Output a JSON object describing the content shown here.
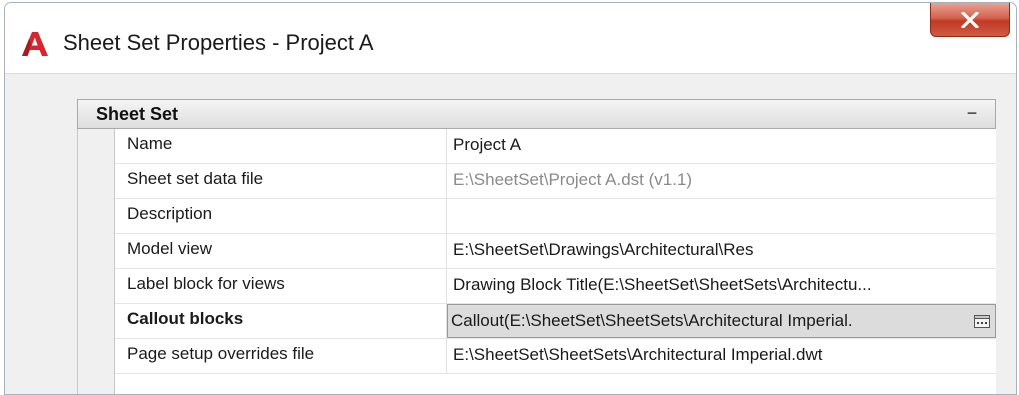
{
  "window": {
    "title": "Sheet Set Properties - Project A",
    "close_label": "X"
  },
  "category": {
    "title": "Sheet Set",
    "collapse_symbol": "−"
  },
  "properties": [
    {
      "name": "Name",
      "value": "Project A"
    },
    {
      "name": "Sheet set data file",
      "value": "E:\\SheetSet\\Project A.dst (v1.1)"
    },
    {
      "name": "Description",
      "value": ""
    },
    {
      "name": "Model view",
      "value": "E:\\SheetSet\\Drawings\\Architectural\\Res"
    },
    {
      "name": "Label block for views",
      "value": "Drawing Block Title(E:\\SheetSet\\SheetSets\\Architectu..."
    },
    {
      "name": "Callout blocks",
      "value": "Callout(E:\\SheetSet\\SheetSets\\Architectural Imperial."
    },
    {
      "name": "Page setup overrides file",
      "value": "E:\\SheetSet\\SheetSets\\Architectural Imperial.dwt"
    }
  ],
  "colors": {
    "brand_red": "#d7262d",
    "close_button": "#c9452f",
    "readonly_text": "#8a8a8a"
  },
  "icons": {
    "app": "autocad-logo-icon",
    "close": "close-icon",
    "browse": "browse-ellipsis-icon"
  }
}
